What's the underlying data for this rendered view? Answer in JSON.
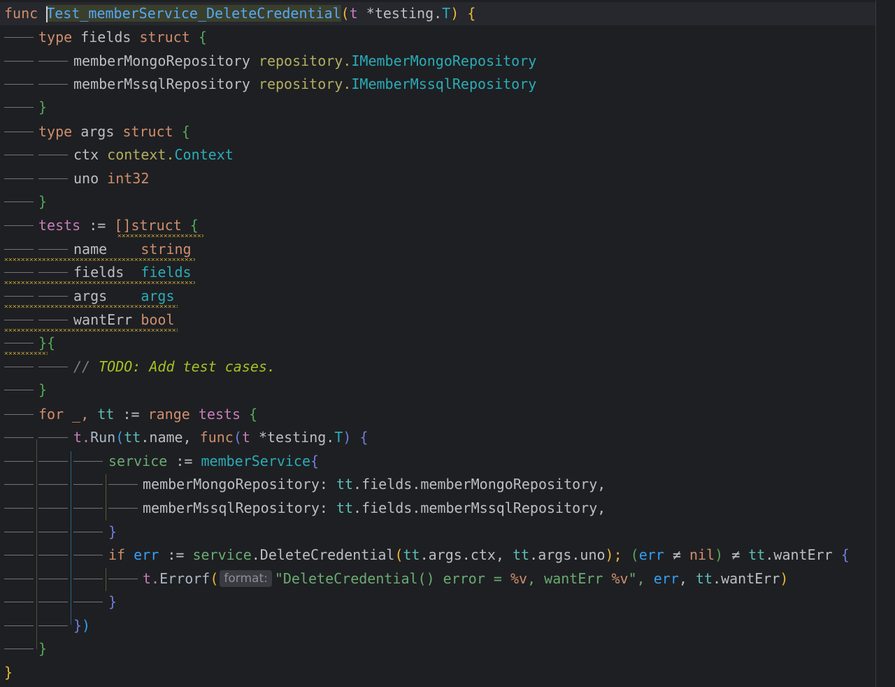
{
  "editor": {
    "language": "go",
    "lines": [
      {
        "indent": 0,
        "text": "func Test_memberService_DeleteCredential(t *testing.T) {"
      },
      {
        "indent": 1,
        "text": "type fields struct {"
      },
      {
        "indent": 2,
        "text": "memberMongoRepository repository.IMemberMongoRepository"
      },
      {
        "indent": 2,
        "text": "memberMssqlRepository repository.IMemberMssqlRepository"
      },
      {
        "indent": 1,
        "text": "}"
      },
      {
        "indent": 1,
        "text": "type args struct {"
      },
      {
        "indent": 2,
        "text": "ctx context.Context"
      },
      {
        "indent": 2,
        "text": "uno int32"
      },
      {
        "indent": 1,
        "text": "}"
      },
      {
        "indent": 1,
        "text": "tests := []struct {"
      },
      {
        "indent": 2,
        "text": "name    string"
      },
      {
        "indent": 2,
        "text": "fields  fields"
      },
      {
        "indent": 2,
        "text": "args    args"
      },
      {
        "indent": 2,
        "text": "wantErr bool"
      },
      {
        "indent": 1,
        "text": "}{"
      },
      {
        "indent": 2,
        "text": "// TODO: Add test cases."
      },
      {
        "indent": 1,
        "text": "}"
      },
      {
        "indent": 1,
        "text": "for _, tt := range tests {"
      },
      {
        "indent": 2,
        "text": "t.Run(tt.name, func(t *testing.T) {"
      },
      {
        "indent": 3,
        "text": "service := memberService{"
      },
      {
        "indent": 4,
        "text": "memberMongoRepository: tt.fields.memberMongoRepository,"
      },
      {
        "indent": 4,
        "text": "memberMssqlRepository: tt.fields.memberMssqlRepository,"
      },
      {
        "indent": 3,
        "text": "}"
      },
      {
        "indent": 3,
        "text": "if err := service.DeleteCredential(tt.args.ctx, tt.args.uno); (err != nil) != tt.wantErr {"
      },
      {
        "indent": 4,
        "text": "t.Errorf(\"DeleteCredential() error = %v, wantErr %v\", err, tt.wantErr)"
      },
      {
        "indent": 3,
        "text": "}"
      },
      {
        "indent": 2,
        "text": "})"
      },
      {
        "indent": 1,
        "text": "}"
      },
      {
        "indent": 0,
        "text": "}"
      }
    ],
    "inlay_hint_format": "format:"
  },
  "tokens": {
    "l0": [
      "func",
      "Test_memberService_DeleteCredential",
      "(",
      "t",
      "*testing.",
      "T",
      ")",
      "{"
    ],
    "l1": [
      "type",
      "fields",
      "struct",
      "{"
    ],
    "l2": [
      "memberMongoRepository",
      "repository.",
      "IMemberMongoRepository"
    ],
    "l3": [
      "memberMssqlRepository",
      "repository.",
      "IMemberMssqlRepository"
    ],
    "l4": [
      "}"
    ],
    "l5": [
      "type",
      "args",
      "struct",
      "{"
    ],
    "l6": [
      "ctx",
      "context.",
      "Context"
    ],
    "l7": [
      "uno",
      "int32"
    ],
    "l8": [
      "}"
    ],
    "l9": [
      "tests",
      ":=",
      "[]struct",
      "{"
    ],
    "l10": [
      "name",
      "string"
    ],
    "l11": [
      "fields",
      "fields"
    ],
    "l12": [
      "args",
      "args"
    ],
    "l13": [
      "wantErr",
      "bool"
    ],
    "l14": [
      "}{"
    ],
    "l15": [
      "//",
      "TODO: Add test cases."
    ],
    "l16": [
      "}"
    ],
    "l17": [
      "for",
      "_,",
      "tt",
      ":=",
      "range",
      "tests",
      "{"
    ],
    "l18": [
      "t.",
      "Run",
      "(",
      "tt",
      ".name,",
      "func",
      "(",
      "t",
      "*testing.",
      "T",
      ")",
      "{"
    ],
    "l19": [
      "service",
      ":=",
      "memberService",
      "{"
    ],
    "l20": [
      "memberMongoRepository:",
      "tt",
      ".fields.memberMongoRepository,"
    ],
    "l21": [
      "memberMssqlRepository:",
      "tt",
      ".fields.memberMssqlRepository,"
    ],
    "l22": [
      "}"
    ],
    "l23": [
      "if",
      "err",
      ":=",
      "service",
      ".DeleteCredential",
      "(",
      "tt",
      ".args.ctx,",
      "tt",
      ".args.uno",
      ");",
      "(",
      "err",
      "≠",
      "nil",
      ")",
      "≠",
      "tt",
      ".wantErr",
      "{"
    ],
    "l24": [
      "t.",
      "Errorf",
      "(",
      "\"DeleteCredential() error = ",
      "%v",
      ", wantErr ",
      "%v",
      "\",",
      "err",
      ",",
      "tt",
      ".wantErr",
      ")"
    ],
    "l25": [
      "}"
    ],
    "l26": [
      "}",
      ")"
    ],
    "l27": [
      "}"
    ],
    "l28": [
      "}"
    ]
  },
  "colors": {
    "background": "#1e1f22",
    "keyword": "#cf8e6d",
    "function": "#56a8f5",
    "type": "#2aacb8",
    "string": "#6aab73",
    "todo": "#a8c023"
  }
}
